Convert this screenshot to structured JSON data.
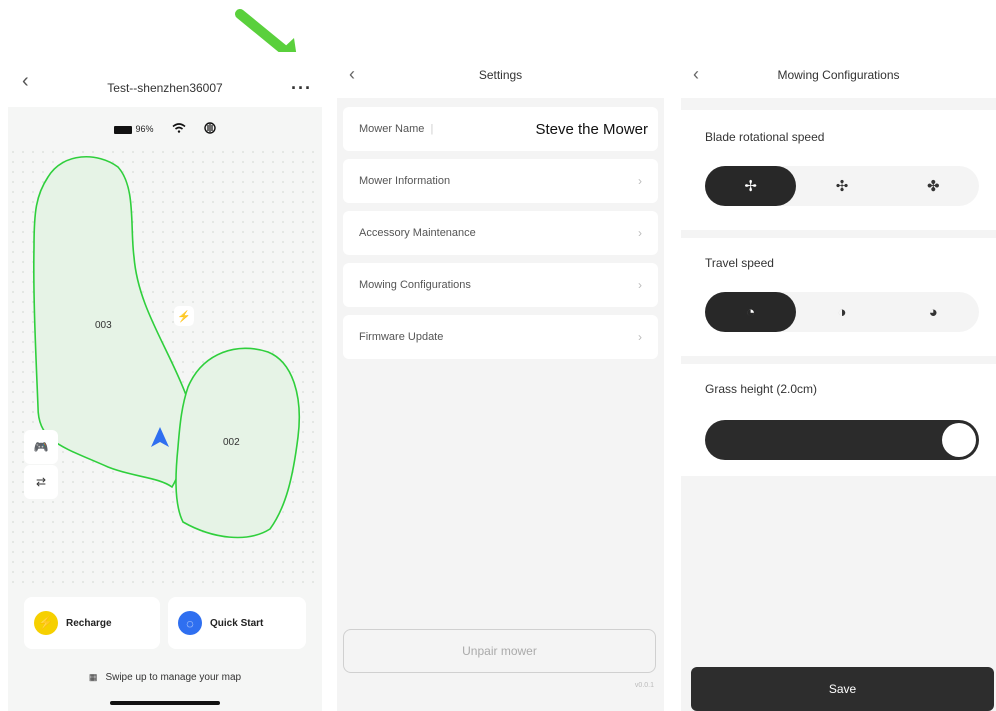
{
  "screen_map": {
    "title": "Test--shenzhen36007",
    "more_icon": "ellipsis-icon",
    "battery": "96%",
    "zones": [
      "003",
      "002"
    ],
    "recharge_label": "Recharge",
    "quick_start_label": "Quick Start",
    "swipe_hint": "Swipe up to manage your map",
    "accent_green": "#2fcf3c",
    "zone_fill": "#e6f3e6"
  },
  "screen_settings": {
    "title": "Settings",
    "mower_name_label": "Mower Name",
    "mower_name_value": "Steve the Mower",
    "items": [
      "Mower Information",
      "Accessory Maintenance",
      "Mowing Configurations",
      "Firmware Update"
    ],
    "unpair_label": "Unpair mower",
    "version": "v0.0.1"
  },
  "screen_config": {
    "title": "Mowing Configurations",
    "blade_label": "Blade rotational speed",
    "travel_label": "Travel speed",
    "grass_label": "Grass height (2.0cm)",
    "grass_level_fraction": 1.0,
    "blade_selected": 0,
    "travel_selected": 0,
    "save_label": "Save"
  }
}
